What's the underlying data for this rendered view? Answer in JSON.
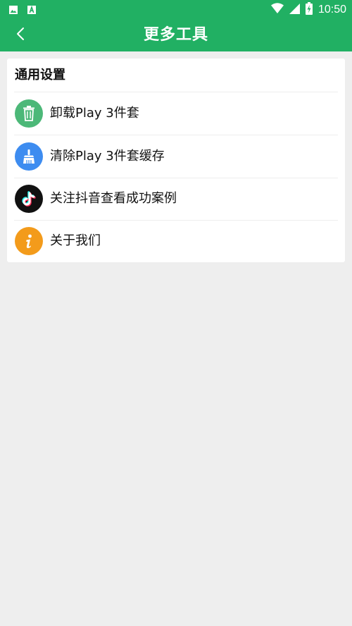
{
  "status_bar": {
    "time": "10:50",
    "left_icons": [
      "gallery-icon",
      "text-app-icon"
    ],
    "right_icons": [
      "wifi-icon",
      "cellular-icon",
      "battery-charging-icon"
    ]
  },
  "header": {
    "title": "更多工具",
    "back_icon": "chevron-left-icon"
  },
  "section": {
    "title": "通用设置",
    "items": [
      {
        "label": "卸载Play 3件套",
        "icon": "trash-icon",
        "color": "#4cb878"
      },
      {
        "label": "清除Play 3件套缓存",
        "icon": "broom-icon",
        "color": "#3d8cf0"
      },
      {
        "label": "关注抖音查看成功案例",
        "icon": "tiktok-icon",
        "color": "#111111"
      },
      {
        "label": "关于我们",
        "icon": "info-icon",
        "color": "#f39b1b"
      }
    ]
  },
  "colors": {
    "primary": "#21b063",
    "background": "#eeeeee",
    "card": "#ffffff"
  }
}
